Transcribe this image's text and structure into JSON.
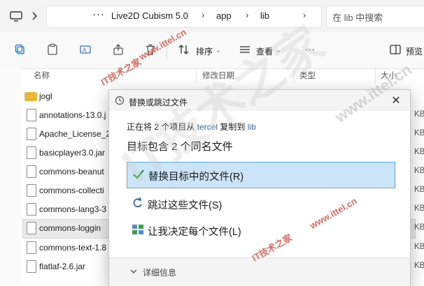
{
  "address": {
    "breadcrumbs": [
      "Live2D Cubism 5.0",
      "app",
      "lib"
    ],
    "search_placeholder": "在 lib 中搜索"
  },
  "toolbar": {
    "sort_label": "排序",
    "view_label": "查看",
    "preview_label": "预览"
  },
  "columns": {
    "name": "名称",
    "modified": "修改日期",
    "type": "类型",
    "size": "大小"
  },
  "files": [
    {
      "name": "jogl",
      "kind": "folder",
      "size": ""
    },
    {
      "name": "annotations-13.0.j",
      "kind": "file",
      "size": "KB"
    },
    {
      "name": "Apache_License_2",
      "kind": "file",
      "size": "KB"
    },
    {
      "name": "basicplayer3.0.jar",
      "kind": "file",
      "size": "KB"
    },
    {
      "name": "commons-beanut",
      "kind": "file",
      "size": "KB"
    },
    {
      "name": "commons-collecti",
      "kind": "file",
      "size": "KB"
    },
    {
      "name": "commons-lang3-3",
      "kind": "file",
      "size": "KB"
    },
    {
      "name": "commons-loggin",
      "kind": "file",
      "size": "KB"
    },
    {
      "name": "commons-text-1.8",
      "kind": "file",
      "size": "KB"
    },
    {
      "name": "flatlaf-2.6.jar",
      "kind": "file",
      "size": "KB"
    }
  ],
  "dialog": {
    "title": "替换或跳过文件",
    "close": "✕",
    "progress_prefix": "正在将 2 个项目从",
    "progress_source": "tercel",
    "progress_middle": "复制到",
    "progress_dest": "lib",
    "heading": "目标包含 2 个同名文件",
    "option_replace": "替换目标中的文件(R)",
    "option_skip": "跳过这些文件(S)",
    "option_decide": "让我决定每个文件(L)",
    "more_details": "详细信息"
  },
  "watermark": {
    "site": "www.ittel.cn",
    "brand": "IT技术之家",
    "logo": "IT技术之家"
  },
  "colors": {
    "accent": "#0067c0",
    "watermark_red": "#d83a2a",
    "option_highlight": "#cce4f7"
  }
}
